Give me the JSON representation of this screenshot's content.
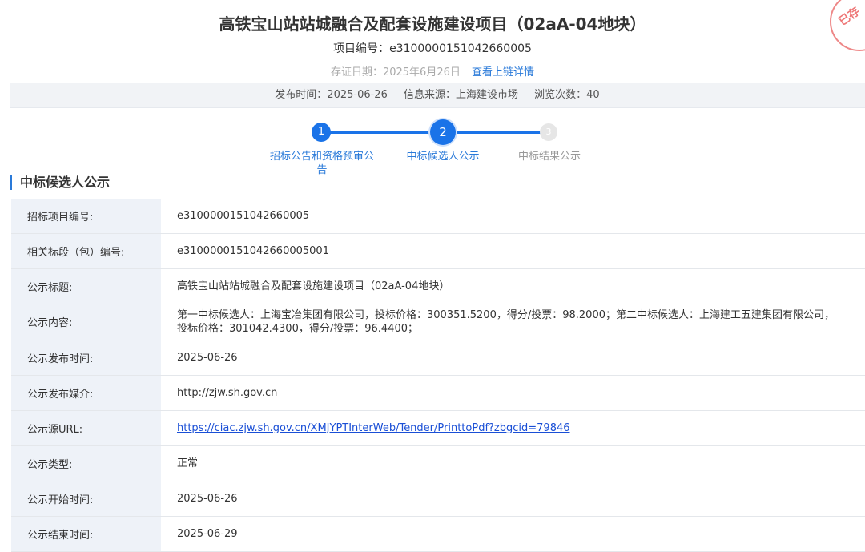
{
  "header": {
    "title": "高铁宝山站站城融合及配套设施建设项目（02aA-04地块）",
    "project_no_label": "项目编号：",
    "project_no": "e3100000151042660005",
    "evidence_date": "存证日期：2025年6月26日",
    "chain_link": "查看上链详情",
    "stamp_text": "已存"
  },
  "info_bar": {
    "publish_time": "发布时间：2025-06-26",
    "source": "信息来源：上海建设市场",
    "views": "浏览次数：40"
  },
  "steps": [
    {
      "num": "1",
      "label": "招标公告和资格预审公告",
      "state": "done"
    },
    {
      "num": "2",
      "label": "中标候选人公示",
      "state": "current"
    },
    {
      "num": "3",
      "label": "中标结果公示",
      "state": "pending"
    }
  ],
  "section_title": "中标候选人公示",
  "rows": [
    {
      "label": "招标项目编号:",
      "value": "e3100000151042660005"
    },
    {
      "label": "相关标段（包）编号:",
      "value": "e3100000151042660005001"
    },
    {
      "label": "公示标题:",
      "value": "高铁宝山站站城融合及配套设施建设项目（02aA-04地块）"
    },
    {
      "label": "公示内容:",
      "value": "第一中标候选人：上海宝冶集团有限公司，投标价格：300351.5200，得分/投票：98.2000；第二中标候选人：上海建工五建集团有限公司，投标价格：301042.4300，得分/投票：96.4400；"
    },
    {
      "label": "公示发布时间:",
      "value": "2025-06-26"
    },
    {
      "label": "公示发布媒介:",
      "value": "http://zjw.sh.gov.cn"
    },
    {
      "label": "公示源URL:",
      "value": "https://ciac.zjw.sh.gov.cn/XMJYPTInterWeb/Tender/PrinttoPdf?zbgcid=79846"
    },
    {
      "label": "公示类型:",
      "value": "正常"
    },
    {
      "label": "公示开始时间:",
      "value": "2025-06-26"
    },
    {
      "label": "公示结束时间:",
      "value": "2025-06-29"
    }
  ]
}
